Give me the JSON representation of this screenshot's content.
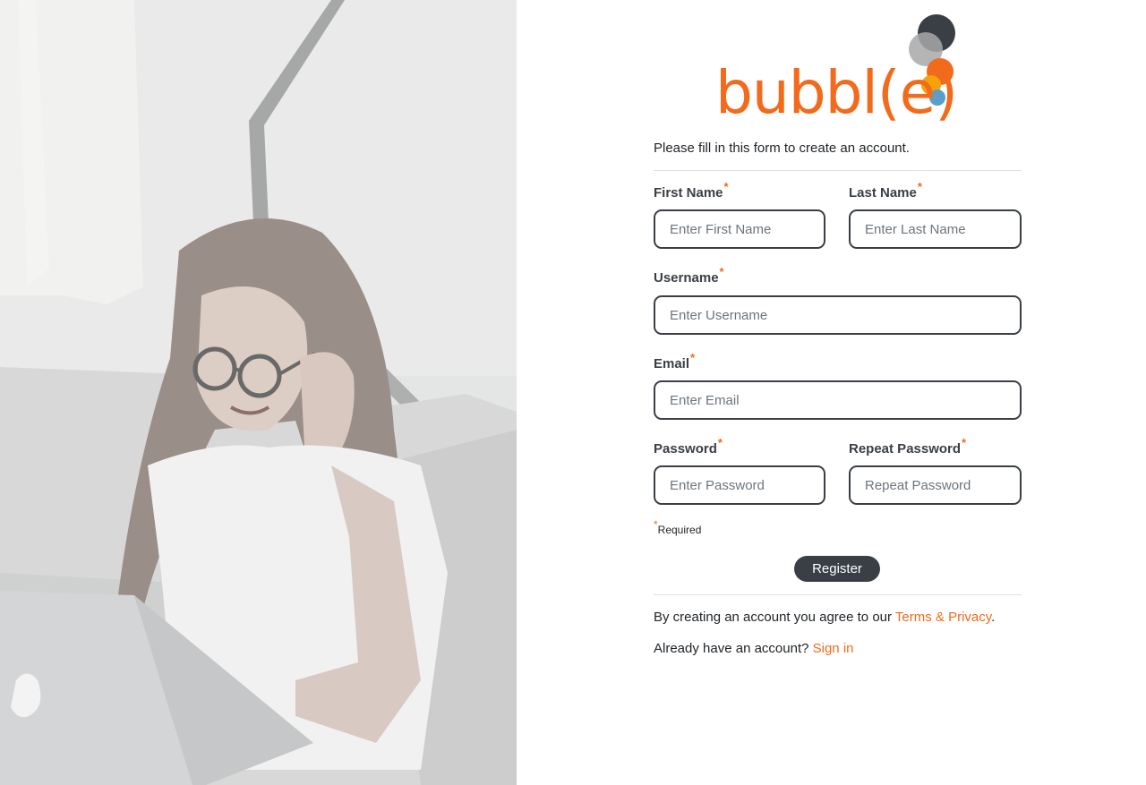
{
  "brand": {
    "logo_text": "bubbl(e)",
    "accent_color": "#f26a1b",
    "dark_color": "#3a3f45"
  },
  "form": {
    "intro": "Please fill in this form to create an account.",
    "required_marker": "*",
    "fields": {
      "first_name": {
        "label": "First Name",
        "placeholder": "Enter First Name"
      },
      "last_name": {
        "label": "Last Name",
        "placeholder": "Enter Last Name"
      },
      "username": {
        "label": "Username",
        "placeholder": "Enter Username"
      },
      "email": {
        "label": "Email",
        "placeholder": "Enter Email"
      },
      "password": {
        "label": "Password",
        "placeholder": "Enter Password"
      },
      "repeat_password": {
        "label": "Repeat Password",
        "placeholder": "Repeat Password"
      }
    },
    "required_note": "Required",
    "register_label": "Register"
  },
  "footer": {
    "agree_prefix": "By creating an account you agree to our ",
    "terms_link": "Terms & Privacy",
    "agree_suffix": ".",
    "signin_prefix": "Already have an account? ",
    "signin_link": "Sign in"
  }
}
